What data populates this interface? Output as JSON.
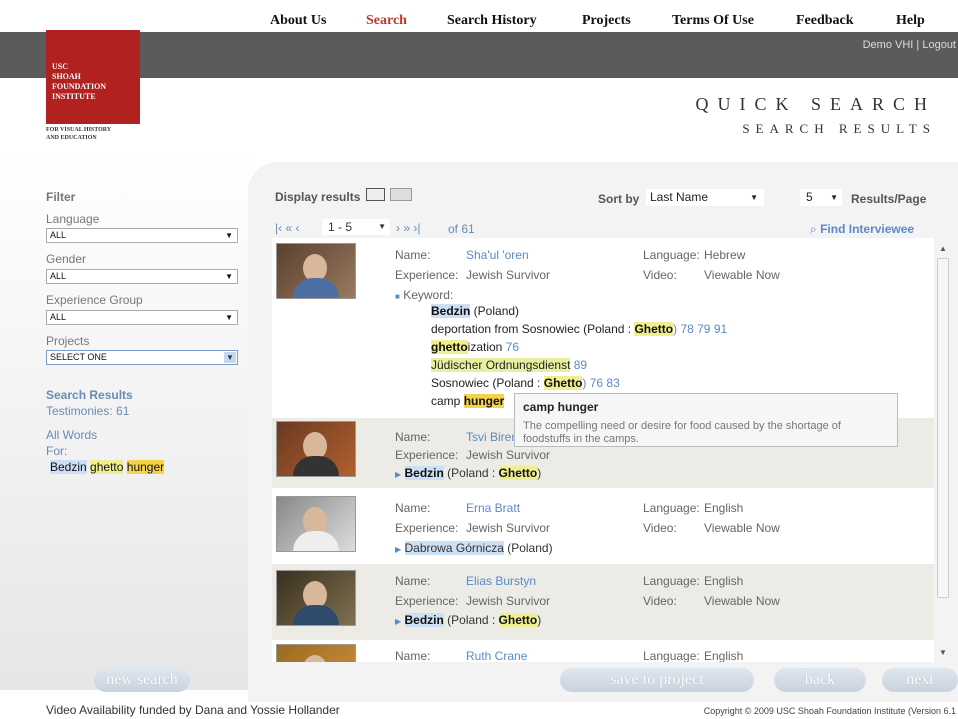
{
  "nav": {
    "items": [
      "About Us",
      "Search",
      "Search History",
      "Projects",
      "Terms Of Use",
      "Feedback",
      "Help"
    ],
    "user": "Demo VHI",
    "logout": "Logout"
  },
  "logo": {
    "line1": "USC",
    "line2": "SHOAH",
    "line3": "FOUNDATION",
    "line4": "INSTITUTE",
    "sub1": "FOR VISUAL HISTORY",
    "sub2": "AND EDUCATION"
  },
  "page": {
    "title": "QUICK SEARCH",
    "subtitle": "SEARCH RESULTS"
  },
  "filter": {
    "heading": "Filter",
    "language_label": "Language",
    "language_value": "ALL",
    "gender_label": "Gender",
    "gender_value": "ALL",
    "experience_label": "Experience Group",
    "experience_value": "ALL",
    "projects_label": "Projects",
    "projects_value": "SELECT ONE"
  },
  "summary": {
    "heading": "Search Results",
    "testimonies": "Testimonies: 61",
    "allwords": "All Words",
    "for": "For:",
    "terms": [
      "Bedzin",
      "ghetto",
      "hunger"
    ]
  },
  "toolbar": {
    "display_results": "Display results",
    "sort_by": "Sort by",
    "sort_value": "Last Name",
    "per_page": "5",
    "per_page_label": "Results/Page",
    "range": "1 - 5",
    "of": "of 61",
    "find_interviewee": "Find Interviewee"
  },
  "labels": {
    "name": "Name:",
    "experience": "Experience:",
    "language": "Language:",
    "video": "Video:",
    "keyword": "Keyword:"
  },
  "results": [
    {
      "name": "Sha'ul 'oren",
      "experience": "Jewish Survivor",
      "language": "Hebrew",
      "video": "Viewable Now",
      "kw_bedzin": "Bedzin",
      "kw_bedzin_loc": " (Poland)",
      "kw2_a": "deportation from Sosnowiec (Poland : ",
      "kw2_b": "Ghetto",
      "kw2_c": ") 78 79 91",
      "kw3_a": "ghetto",
      "kw3_b": "ization",
      "kw3_c": " 76",
      "kw4_a": "Jüdischer Ordnungsdienst",
      "kw4_b": " 89",
      "kw5_a": "Sosnowiec (Poland : ",
      "kw5_b": "Ghetto",
      "kw5_c": ") 76 83",
      "kw6_a": "camp ",
      "kw6_b": "hunger"
    },
    {
      "name": "Tsvi Birenbaum",
      "experience": "Jewish Survivor",
      "loc_a": "Bedzin",
      "loc_b": " (Poland : ",
      "loc_c": "Ghetto",
      "loc_d": ")"
    },
    {
      "name": "Erna Bratt",
      "experience": "Jewish Survivor",
      "language": "English",
      "video": "Viewable Now",
      "loc_a": "Dabrowa Górnicza",
      "loc_b": " (Poland)"
    },
    {
      "name": "Elias Burstyn",
      "experience": "Jewish Survivor",
      "language": "English",
      "video": "Viewable Now",
      "loc_a": "Bedzin",
      "loc_b": " (Poland : ",
      "loc_c": "Ghetto",
      "loc_d": ")"
    },
    {
      "name": "Ruth Crane",
      "language": "English"
    }
  ],
  "tooltip": {
    "title": "camp hunger",
    "body": "The compelling need or desire for food caused by the shortage of foodstuffs in the camps."
  },
  "buttons": {
    "new_search": "new search",
    "save": "save to project",
    "back": "back",
    "next": "next"
  },
  "footer": {
    "left": "Video Availability funded by Dana and Yossie Hollander",
    "right": "Copyright © 2009 USC Shoah Foundation Institute (Version 6.1"
  }
}
